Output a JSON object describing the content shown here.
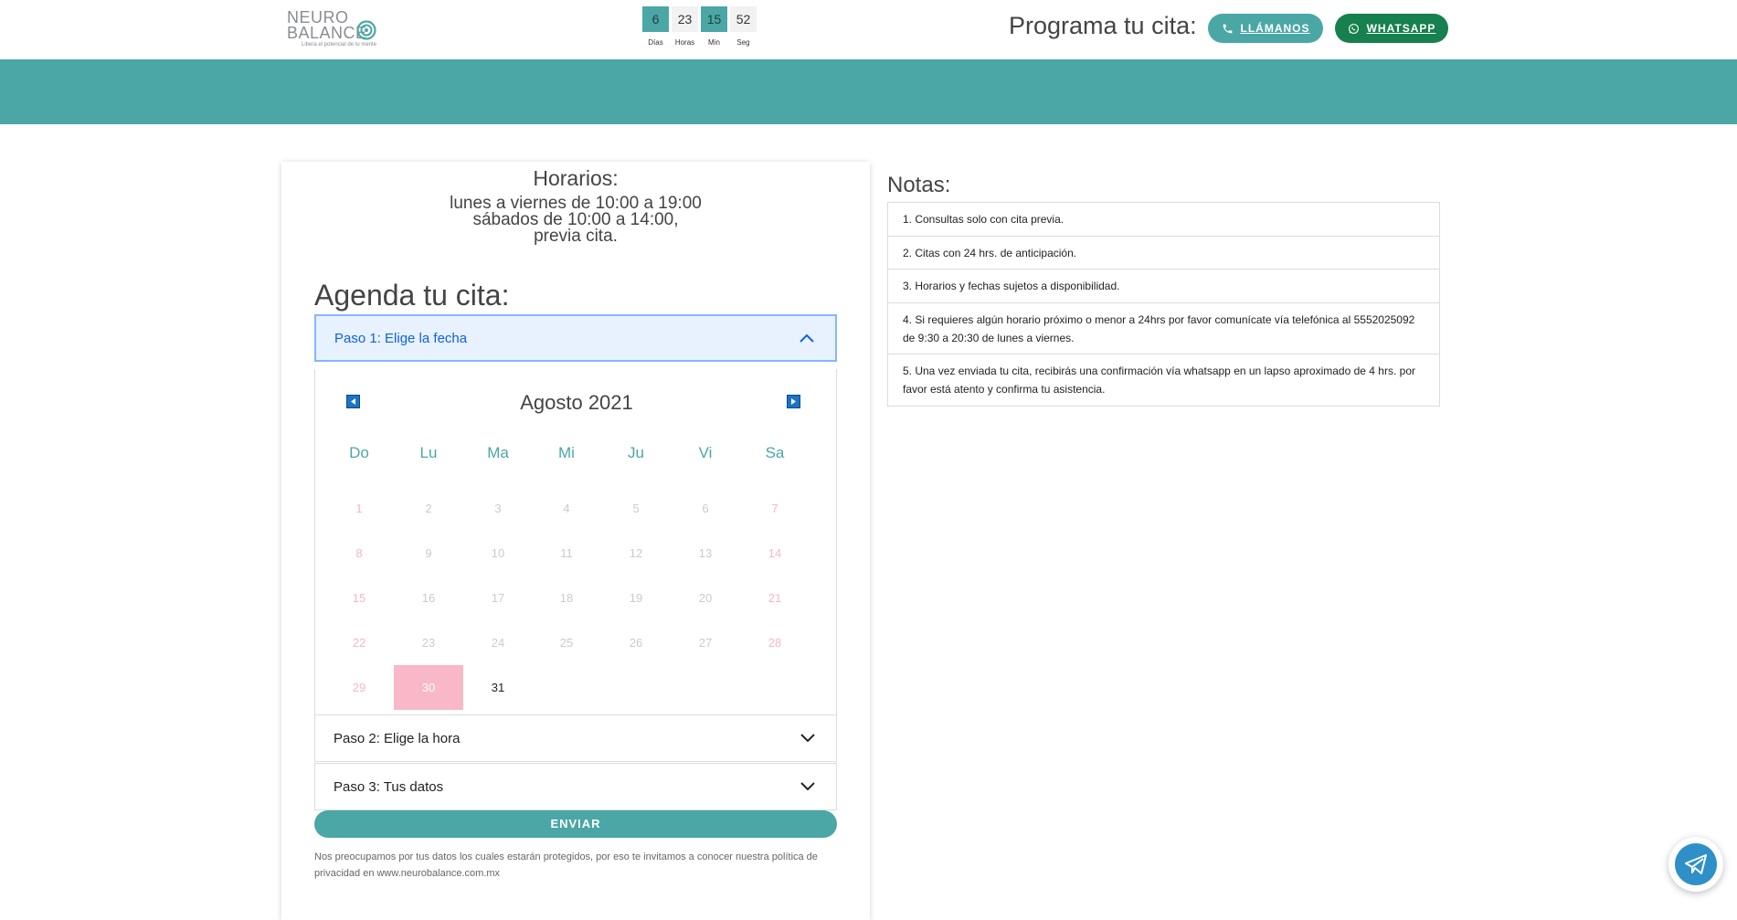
{
  "header": {
    "logo_line1": "NEURO",
    "logo_line2": "BALANCE",
    "logo_tagline": "Libera el potencial de tu mente",
    "cta_text": "Programa tu cita:",
    "call_label": "LLÁMANOS",
    "whatsapp_label": "WHATSAPP",
    "call_color": "#4aa7a5",
    "whatsapp_color": "#16804e"
  },
  "countdown": [
    {
      "value": "6",
      "label": "Días"
    },
    {
      "value": "23",
      "label": "Horas"
    },
    {
      "value": "15",
      "label": "Min"
    },
    {
      "value": "52",
      "label": "Seg"
    }
  ],
  "banner": {
    "color": "#4aa7a5"
  },
  "hours": {
    "title": "Horarios:",
    "line1": "lunes a viernes de 10:00 a 19:00",
    "line2": "sábados de 10:00 a 14:00,",
    "line3": "previa cita."
  },
  "agenda": {
    "title": "Agenda tu cita:",
    "step1": "Paso 1: Elige la fecha",
    "step2": "Paso 2: Elige la hora",
    "step3": "Paso 3: Tus datos",
    "send_label": "ENVIAR",
    "privacy_text": "Nos preocupamos por tus datos los cuales estarán protegidos, por eso te invitamos a conocer nuestra política de privacidad en www.neurobalance.com.mx"
  },
  "calendar": {
    "month_label": "Agosto 2021",
    "weekdays": [
      "Do",
      "Lu",
      "Ma",
      "Mi",
      "Ju",
      "Vi",
      "Sa"
    ],
    "selected_day": "30",
    "available_days": [
      "31"
    ],
    "weeks": [
      [
        "1",
        "2",
        "3",
        "4",
        "5",
        "6",
        "7"
      ],
      [
        "8",
        "9",
        "10",
        "11",
        "12",
        "13",
        "14"
      ],
      [
        "15",
        "16",
        "17",
        "18",
        "19",
        "20",
        "21"
      ],
      [
        "22",
        "23",
        "24",
        "25",
        "26",
        "27",
        "28"
      ],
      [
        "29",
        "30",
        "31"
      ]
    ]
  },
  "notes": {
    "title": "Notas:",
    "items": [
      "1. Consultas solo con cita previa.",
      "2. Citas con 24 hrs. de anticipación.",
      "3. Horarios y fechas sujetos a disponibilidad.",
      "4. Si requieres algún horario próximo o menor a 24hrs por favor comunícate vía telefónica al 5552025092 de 9:30 a 20:30 de lunes a viernes.",
      "5. Una vez enviada tu cita, recibirás una confirmación vía whatsapp en un lapso aproximado de 4 hrs. por favor está atento y confirma tu asistencia."
    ]
  }
}
